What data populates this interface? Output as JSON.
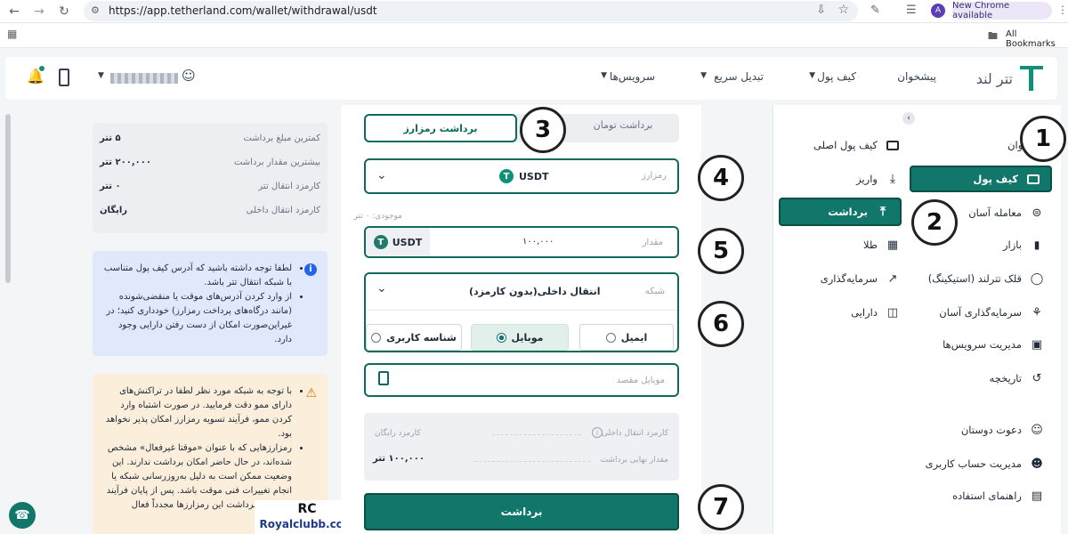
{
  "browser": {
    "url": "https://app.tetherland.com/wallet/withdrawal/usdt",
    "profile_initial": "A",
    "update_chip": "New Chrome available",
    "all_bookmarks": "All Bookmarks"
  },
  "header": {
    "logo_text": "تتر لند",
    "menu": [
      "پیشخوان",
      "کیف پول",
      "تبدیل سریع",
      "سرویس‌ها"
    ]
  },
  "sidebar": {
    "items": [
      {
        "label": "پیشخوان",
        "icon": "home-icon"
      },
      {
        "label": "کیف پول",
        "icon": "wallet-icon",
        "active": true
      },
      {
        "label": "معامله آسان",
        "icon": "exchange-icon"
      },
      {
        "label": "بازار",
        "icon": "chart-icon"
      },
      {
        "label": "قلک تترلند (استیکینگ)",
        "icon": "piggy-icon"
      },
      {
        "label": "سرمایه‌گذاری آسان",
        "icon": "invest-icon"
      },
      {
        "label": "مدیریت سرویس‌ها",
        "icon": "briefcase-icon"
      },
      {
        "label": "تاریخچه",
        "icon": "history-icon"
      },
      {
        "label": "دعوت دوستان",
        "icon": "user-plus-icon"
      },
      {
        "label": "مدیریت حساب کاربری",
        "icon": "user-gear-icon"
      },
      {
        "label": "راهنمای استفاده",
        "icon": "guide-icon"
      }
    ]
  },
  "submenu": {
    "items": [
      {
        "label": "کیف پول اصلی",
        "icon": "wallet-icon"
      },
      {
        "label": "واریز",
        "icon": "download-icon"
      },
      {
        "label": "برداشت",
        "icon": "upload-icon",
        "active": true
      },
      {
        "label": "طلا",
        "icon": "gold-icon"
      },
      {
        "label": "سرمایه‌گذاری",
        "icon": "trend-icon"
      },
      {
        "label": "دارایی",
        "icon": "book-icon"
      }
    ]
  },
  "form": {
    "tab_toman": "برداشت تومان",
    "tab_crypto": "برداشت رمزارز",
    "currency_label": "رمزارز",
    "currency_value": "USDT",
    "balance_text": "موجودی: ۰ تتر",
    "amount_label": "مقدار",
    "amount_value": "۱۰۰,۰۰۰",
    "amount_unit": "USDT",
    "network_label": "شبکه",
    "network_value": "انتقال داخلی(بدون کارمزد)",
    "options": [
      "ایمیل",
      "موبایل",
      "شناسه کاربری"
    ],
    "selected_option": "موبایل",
    "dest_placeholder": "موبایل مقصد",
    "fee_label": "کارمزد انتقال داخلی",
    "fee_value": "کارمزد رایگان",
    "final_label": "مقدار نهایی برداشت",
    "final_value": "۱۰۰,۰۰۰ تتر",
    "submit": "برداشت"
  },
  "limits": {
    "rows": [
      {
        "label": "کمترین مبلغ برداشت",
        "value": "۵ تتر"
      },
      {
        "label": "بیشترین مقدار برداشت",
        "value": "۲۰۰,۰۰۰ تتر"
      },
      {
        "label": "کارمزد انتقال تتر",
        "value": "۰ تتر"
      },
      {
        "label": "کارمزد انتقال داخلی",
        "value": "رایگان"
      }
    ]
  },
  "info_note": {
    "bullets": [
      "لطفا توجه داشته باشید که آدرس کیف پول متناسب با شبکه انتقال تتر باشد.",
      "از وارد کردن آدرس‌های موقت یا منقضی‌شونده (مانند درگاه‌های پرداخت رمزارز) خودداری کنید؛ در غیراین‌صورت امکان از دست رفتن دارایی وجود دارد."
    ]
  },
  "warn_note": {
    "bullets": [
      "با توجه به شبکه مورد نظر لطفا در تراکنش‌های دارای ممو دقت فرمایید. در صورت اشتباه وارد کردن ممو، فرآیند تسویه رمزارز امکان پذیر نخواهد بود.",
      "رمزارزهایی که با عنوان «موقتا غیرفعال» مشخص شده‌اند، در حال حاضر امکان برداشت ندارند. این وضعیت ممکن است به دلیل به‌روزرسانی شبکه یا انجام تغییرات فنی موقت باشد. پس از پایان فرآیند ... امکان برداشت این رمزارزها مجدداً فعال"
    ]
  },
  "annotations": [
    "1",
    "2",
    "3",
    "4",
    "5",
    "6",
    "7"
  ],
  "watermark": "Royalclubb.com",
  "colors": {
    "accent": "#10776a",
    "accent_dark": "#0e6b5c"
  }
}
